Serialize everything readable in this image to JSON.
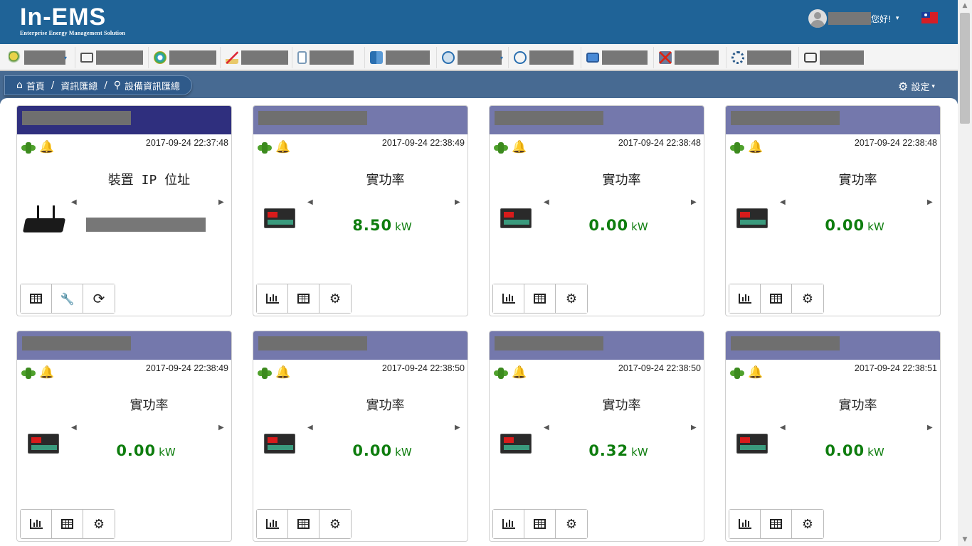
{
  "header": {
    "logo_main": "In-EMS",
    "logo_sub": "Enterprise Energy Management Solution",
    "greeting": "您好!"
  },
  "menu": {
    "items": [
      {
        "icon": "search-icon"
      },
      {
        "icon": "monitor-icon"
      },
      {
        "icon": "gauge-icon"
      },
      {
        "icon": "trend-chart-icon"
      },
      {
        "icon": "report-icon"
      },
      {
        "icon": "box-icon"
      },
      {
        "icon": "meter-icon"
      },
      {
        "icon": "clock-search-icon"
      },
      {
        "icon": "tag-icon"
      },
      {
        "icon": "device-x-icon"
      },
      {
        "icon": "network-gear-icon"
      },
      {
        "icon": "display-icon"
      }
    ]
  },
  "breadcrumb": {
    "home": "首頁",
    "sep1": "/",
    "level1": "資訊匯總",
    "sep2": "/",
    "level2": "設備資訊匯總"
  },
  "settings": {
    "label": "設定"
  },
  "cards": [
    {
      "timestamp": "2017-09-24 22:37:48",
      "title": "裝置 IP 位址"
    },
    {
      "timestamp": "2017-09-24 22:38:49",
      "title": "實功率",
      "value": "8.50",
      "unit": "kW"
    },
    {
      "timestamp": "2017-09-24 22:38:48",
      "title": "實功率",
      "value": "0.00",
      "unit": "kW"
    },
    {
      "timestamp": "2017-09-24 22:38:48",
      "title": "實功率",
      "value": "0.00",
      "unit": "kW"
    },
    {
      "timestamp": "2017-09-24 22:38:49",
      "title": "實功率",
      "value": "0.00",
      "unit": "kW"
    },
    {
      "timestamp": "2017-09-24 22:38:50",
      "title": "實功率",
      "value": "0.00",
      "unit": "kW"
    },
    {
      "timestamp": "2017-09-24 22:38:50",
      "title": "實功率",
      "value": "0.32",
      "unit": "kW"
    },
    {
      "timestamp": "2017-09-24 22:38:51",
      "title": "實功率",
      "value": "0.00",
      "unit": "kW"
    }
  ],
  "glyphs": {
    "arrow_left": "◀",
    "arrow_right": "▶",
    "bell": "🔔",
    "home": "⌂",
    "pin": "⚲",
    "gear": "⚙",
    "caret": "▾",
    "wrench": "🔧",
    "refresh": "⟳",
    "gears": "⚙"
  },
  "colors": {
    "topbar": "#1f6397",
    "card_header": "#7478ac",
    "card_header_active": "#2f2f7e",
    "value_green": "#0e7d0e",
    "alarm_red": "#e01010"
  }
}
